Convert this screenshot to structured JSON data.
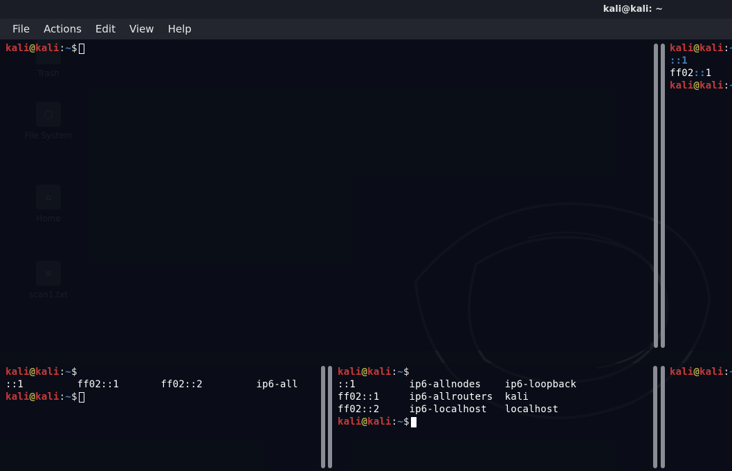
{
  "window": {
    "title": "kali@kali: ~"
  },
  "menu": {
    "file": "File",
    "actions": "Actions",
    "edit": "Edit",
    "view": "View",
    "help": "Help"
  },
  "prompt": {
    "user": "kali",
    "at": "@",
    "host": "kali",
    "colon": ":",
    "path": "~",
    "dollar": "$"
  },
  "desktop": {
    "trash": "Trash",
    "filesystem": "File System",
    "home": "Home",
    "scan": "scan1.txt"
  },
  "pane_top_right": {
    "line1": "::1",
    "line2_a": "ff02",
    "line2_b": "::",
    "line2_c": "1"
  },
  "pane_bottom_left": {
    "line1": "::1         ff02::1       ff02::2         ip6-all"
  },
  "pane_bottom_mid": {
    "line1": "::1         ip6-allnodes    ip6-loopback",
    "line2": "ff02::1     ip6-allrouters  kali",
    "line3": "ff02::2     ip6-localhost   localhost"
  }
}
